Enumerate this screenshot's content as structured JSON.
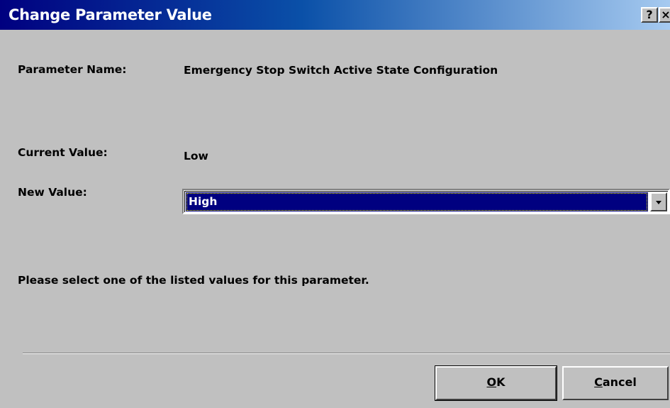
{
  "window": {
    "title": "Change Parameter Value",
    "help_glyph": "?",
    "close_glyph": "×"
  },
  "form": {
    "parameter_name_label": "Parameter Name:",
    "parameter_name_value": "Emergency Stop Switch Active State Configuration",
    "current_value_label": "Current Value:",
    "current_value": "Low",
    "new_value_label": "New Value:",
    "new_value_selected": "High",
    "hint": "Please select one of the listed values for this parameter."
  },
  "buttons": {
    "ok_mnemonic": "O",
    "ok_rest": "K",
    "cancel_mnemonic": "C",
    "cancel_rest": "ancel"
  },
  "colors": {
    "titlebar_start": "#000080",
    "titlebar_end": "#a6caf0",
    "selection": "#000080",
    "dialog_face": "#c0c0c0"
  },
  "icons": [
    "help-icon",
    "close-icon",
    "dropdown-arrow-icon"
  ]
}
